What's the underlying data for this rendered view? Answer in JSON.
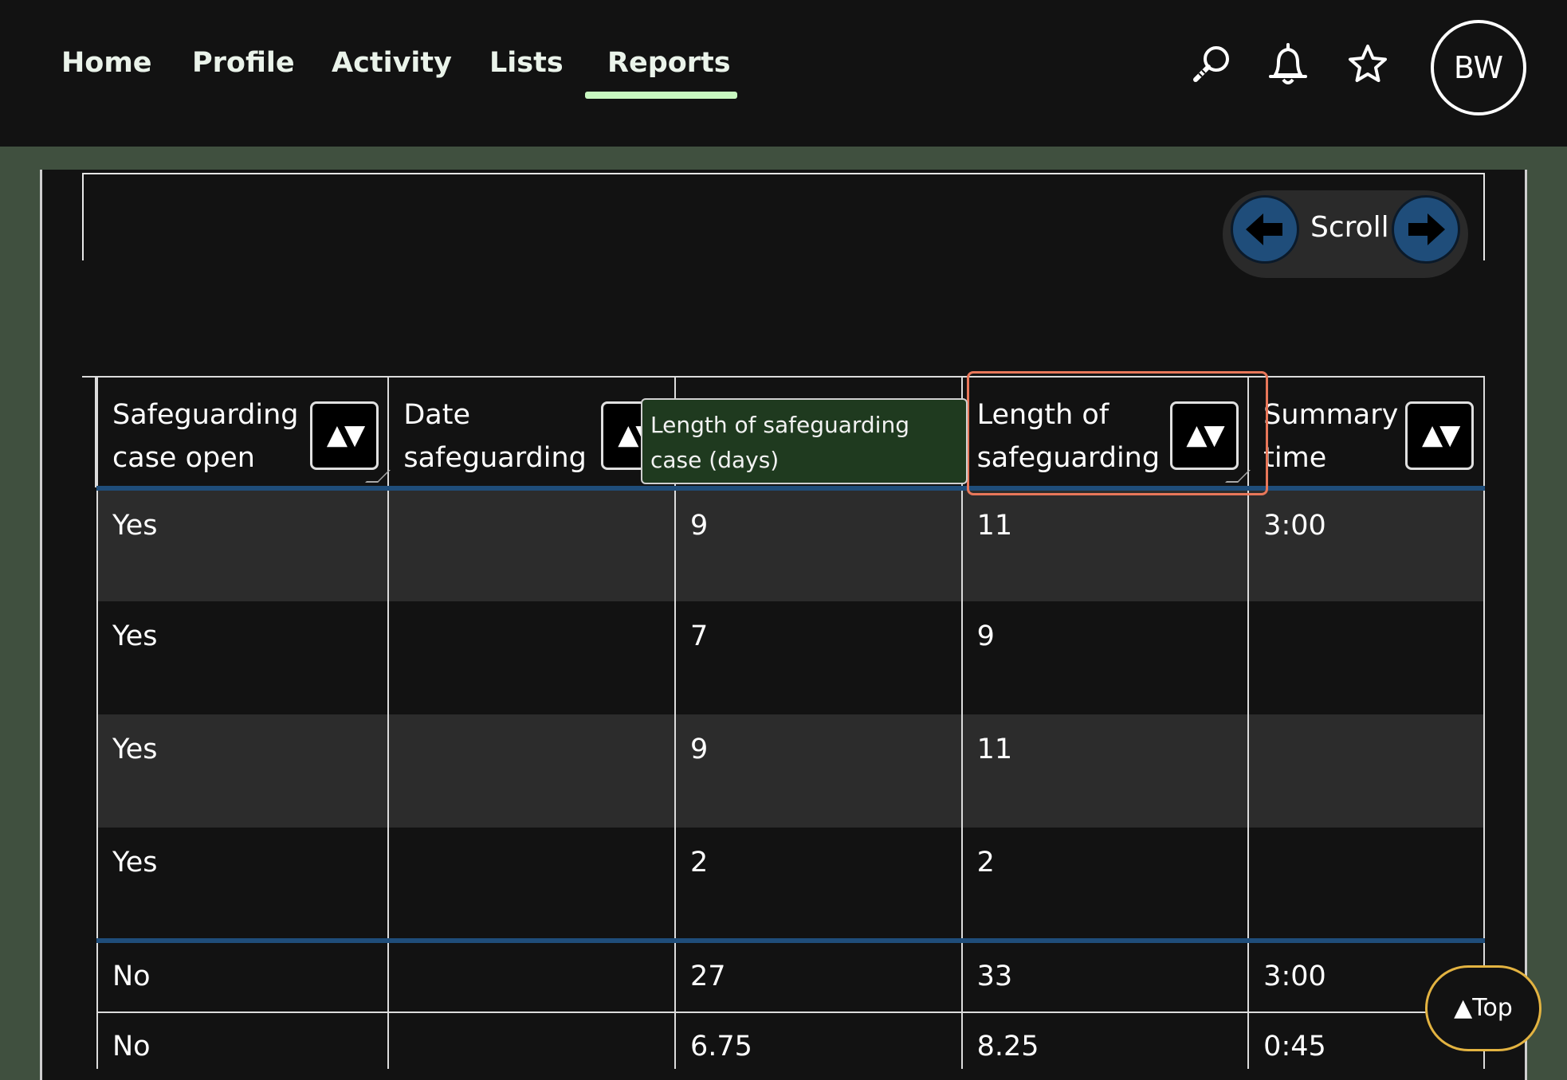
{
  "nav": {
    "items": [
      {
        "label": "Home"
      },
      {
        "label": "Profile"
      },
      {
        "label": "Activity"
      },
      {
        "label": "Lists"
      },
      {
        "label": "Reports",
        "active": true
      }
    ],
    "active_color": "#c8f7c0",
    "icons": [
      "search-icon",
      "bell-icon",
      "star-icon"
    ],
    "avatar_initials": "BW"
  },
  "scroll": {
    "label": "Scroll",
    "left_icon": "arrow-left-icon",
    "right_icon": "arrow-right-icon",
    "button_color": "#1f4d7a"
  },
  "table": {
    "columns": [
      {
        "label": "Safeguarding case open",
        "sort_glyph": "▲▼"
      },
      {
        "label": "Date safeguarding",
        "sort_glyph": "▲▼"
      },
      {
        "label": "",
        "sort_glyph": ""
      },
      {
        "label": "Length of safeguarding",
        "sort_glyph": "▲▼"
      },
      {
        "label": "Summary time",
        "sort_glyph": "▲▼"
      }
    ],
    "rows": [
      [
        "Yes",
        "",
        "9",
        "11",
        "3:00"
      ],
      [
        "Yes",
        "",
        "7",
        "9",
        ""
      ],
      [
        "Yes",
        "",
        "9",
        "11",
        ""
      ],
      [
        "Yes",
        "",
        "2",
        "2",
        ""
      ]
    ],
    "summary_rows": [
      [
        "No",
        "",
        "27",
        "33",
        "3:00"
      ],
      [
        "No",
        "",
        "6.75",
        "8.25",
        "0:45"
      ]
    ]
  },
  "tooltip": {
    "text": "Length of safeguarding case (days)"
  },
  "top_button": {
    "label": "▲Top",
    "border_color": "#e3b341"
  },
  "highlight_color": "#e8775a"
}
